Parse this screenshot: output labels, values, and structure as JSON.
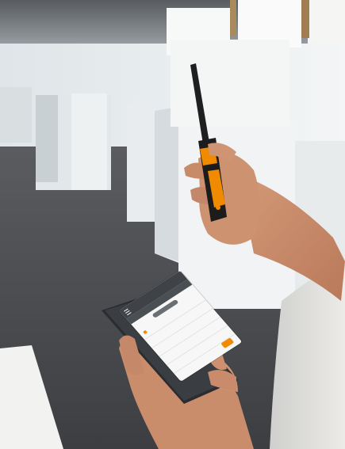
{
  "scene": {
    "description_colors": {
      "floor": "#4b4d51",
      "office_wall": "#e9edef",
      "ceiling": "#5f6266",
      "probe_orange": "#f08a00",
      "probe_black": "#1c1c1c",
      "phone_body": "#2a2c2f",
      "skin": "#c58a6a",
      "shirt": "#e4e4e2"
    }
  },
  "phone_screen": {
    "rows": [
      {
        "label": "",
        "value": ""
      },
      {
        "label": "",
        "value": ""
      },
      {
        "label": "",
        "value": ""
      },
      {
        "label": "",
        "value": ""
      },
      {
        "label": "",
        "value": ""
      }
    ]
  }
}
